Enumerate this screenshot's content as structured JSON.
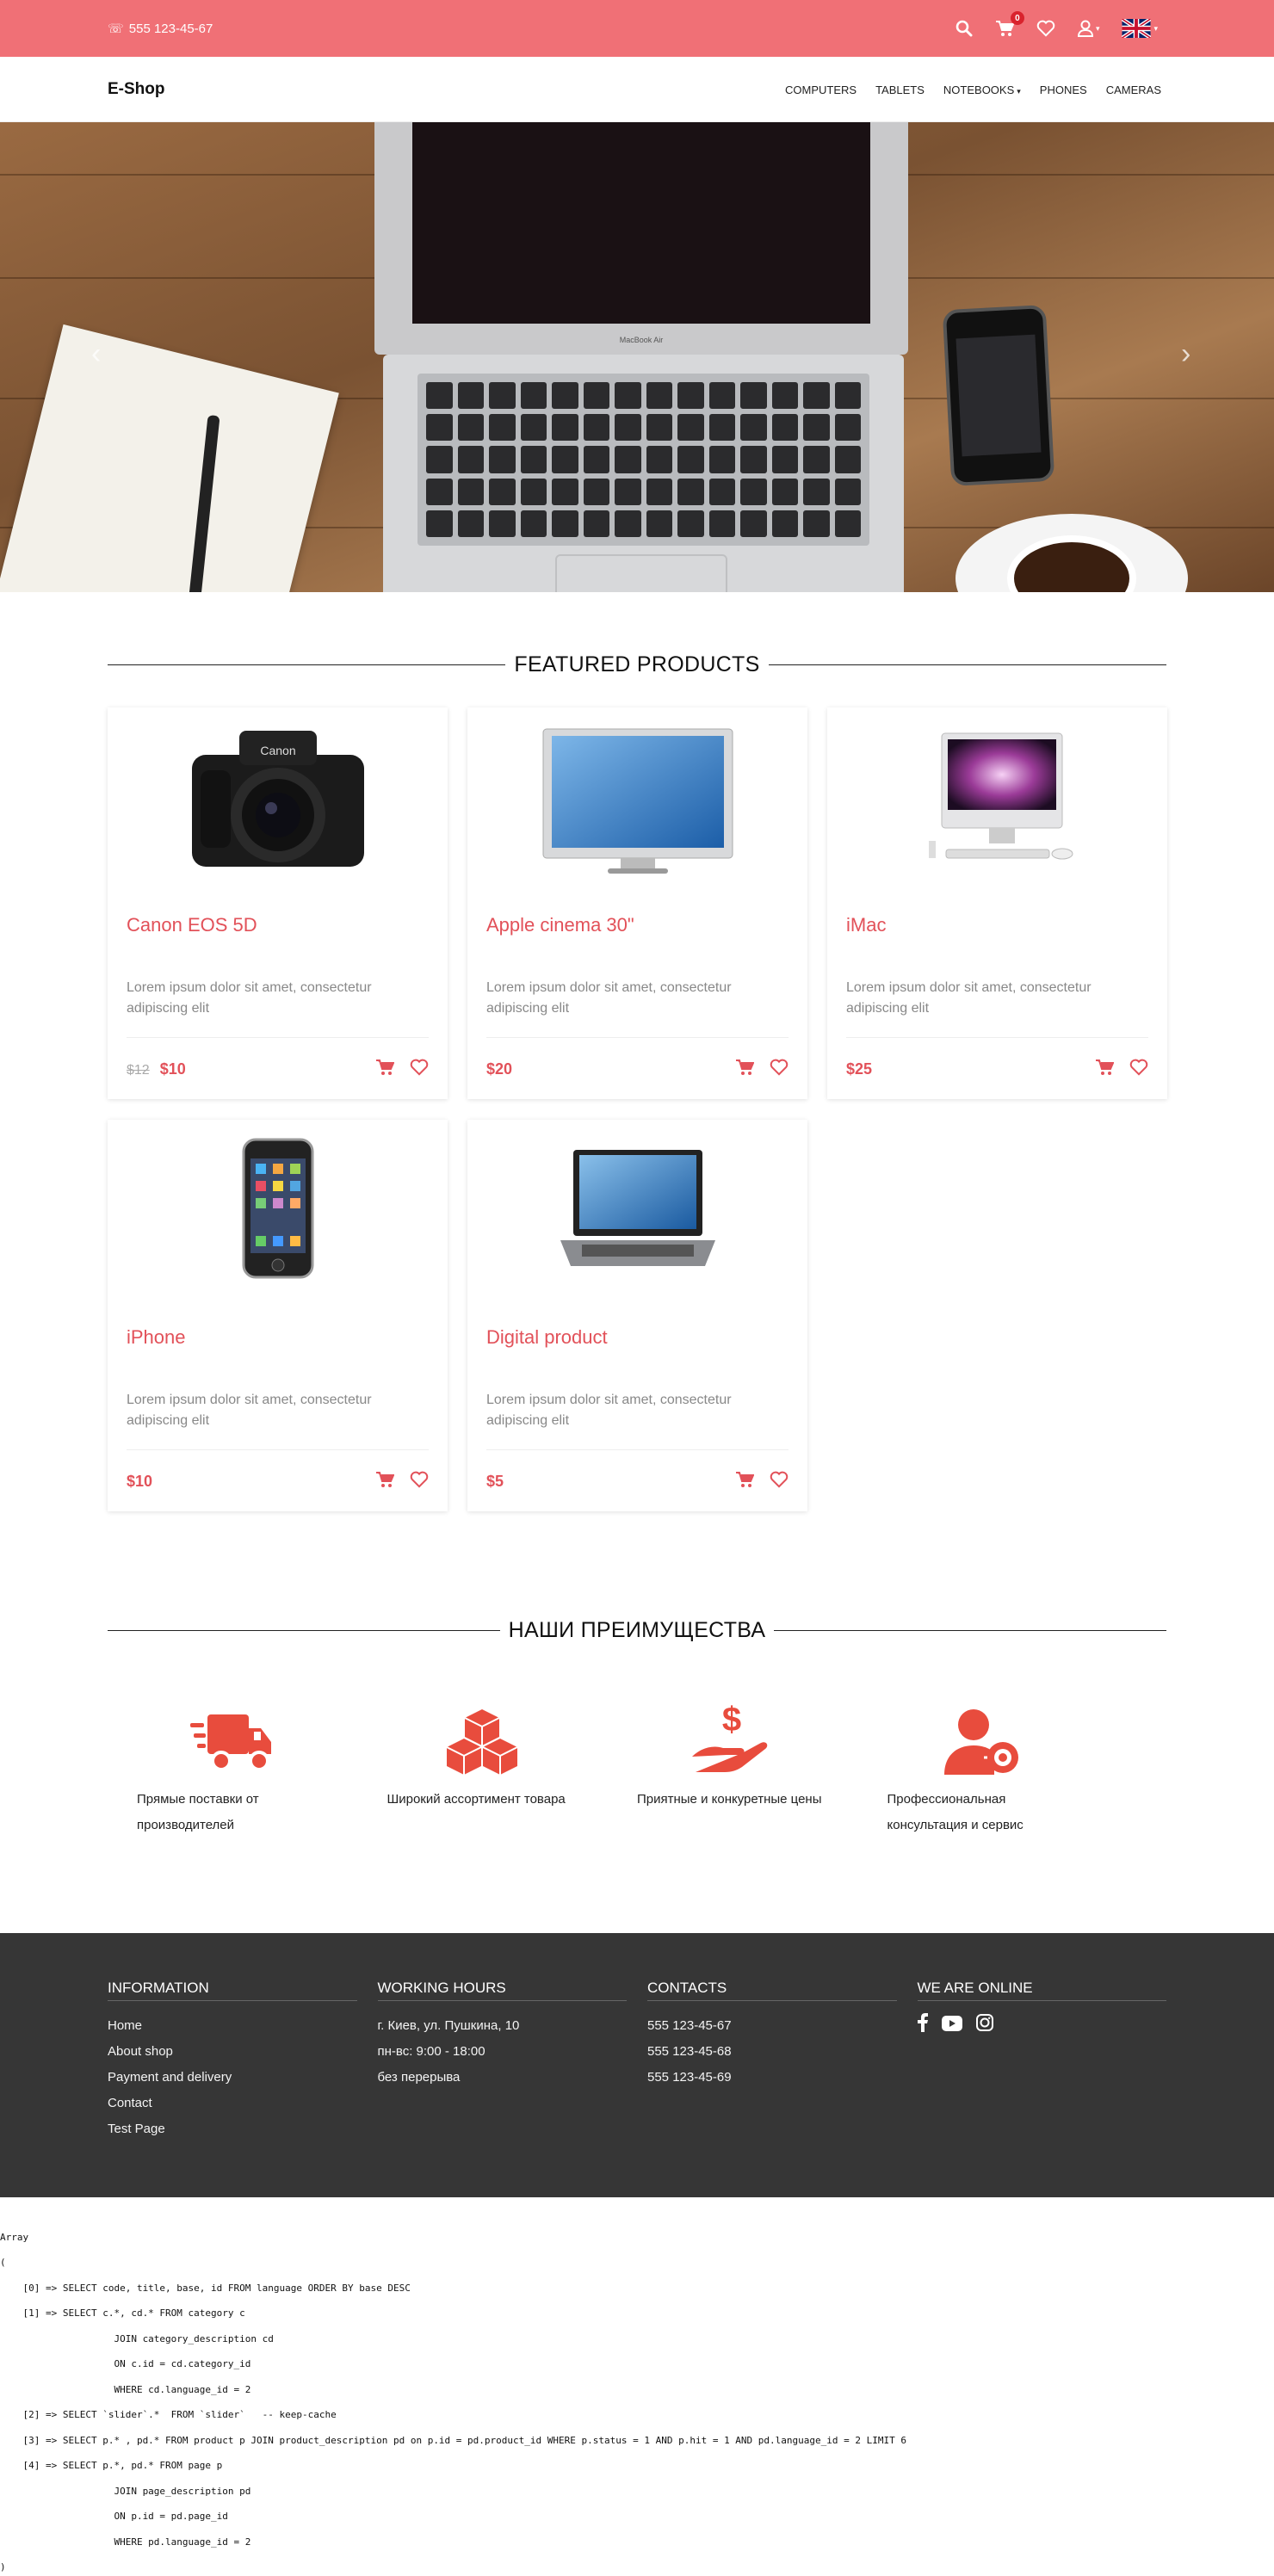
{
  "topbar": {
    "phone": "555 123-45-67",
    "cart_count": "0",
    "colors": {
      "bar": "#f07076",
      "badge": "#d9232d"
    }
  },
  "nav": {
    "brand": "E-Shop",
    "items": [
      "COMPUTERS",
      "TABLETS",
      "NOTEBOOKS",
      "PHONES",
      "CAMERAS"
    ]
  },
  "featured": {
    "title": "FEATURED PRODUCTS",
    "products": [
      {
        "name": "Canon EOS 5D",
        "desc": "Lorem ipsum dolor sit amet, consectetur adipiscing elit",
        "old_price": "$12",
        "price": "$10"
      },
      {
        "name": "Apple cinema 30\"",
        "desc": "Lorem ipsum dolor sit amet, consectetur adipiscing elit",
        "old_price": "",
        "price": "$20"
      },
      {
        "name": "iMac",
        "desc": "Lorem ipsum dolor sit amet, consectetur adipiscing elit",
        "old_price": "",
        "price": "$25"
      },
      {
        "name": "iPhone",
        "desc": "Lorem ipsum dolor sit amet, consectetur adipiscing elit",
        "old_price": "",
        "price": "$10"
      },
      {
        "name": "Digital product",
        "desc": "Lorem ipsum dolor sit amet, consectetur adipiscing elit",
        "old_price": "",
        "price": "$5"
      }
    ]
  },
  "advantages": {
    "title": "НАШИ ПРЕИМУЩЕСТВА",
    "items": [
      {
        "icon": "truck-icon",
        "text": "Прямые поставки от производителей"
      },
      {
        "icon": "boxes-icon",
        "text": "Широкий ассортимент товара"
      },
      {
        "icon": "money-hand-icon",
        "text": "Приятные и конкуретные цены"
      },
      {
        "icon": "user-gear-icon",
        "text": "Профессиональная консультация и сервис"
      }
    ]
  },
  "footer": {
    "information": {
      "title": "INFORMATION",
      "links": [
        "Home",
        "About shop",
        "Payment and delivery",
        "Contact",
        "Test Page"
      ]
    },
    "hours": {
      "title": "WORKING HOURS",
      "lines": [
        "г. Киев, ул. Пушкина, 10",
        "пн-вс: 9:00 - 18:00",
        "без перерыва"
      ]
    },
    "contacts": {
      "title": "CONTACTS",
      "lines": [
        "555 123-45-67",
        "555 123-45-68",
        "555 123-45-69"
      ]
    },
    "online": {
      "title": "WE ARE ONLINE",
      "icons": [
        "facebook-icon",
        "youtube-icon",
        "instagram-icon"
      ]
    }
  },
  "debug": {
    "lines": [
      "Array",
      "(",
      "    [0] => SELECT code, title, base, id FROM language ORDER BY base DESC",
      "    [1] => SELECT c.*, cd.* FROM category c",
      "                    JOIN category_description cd",
      "                    ON c.id = cd.category_id",
      "                    WHERE cd.language_id = 2",
      "    [2] => SELECT `slider`.*  FROM `slider`   -- keep-cache",
      "    [3] => SELECT p.* , pd.* FROM product p JOIN product_description pd on p.id = pd.product_id WHERE p.status = 1 AND p.hit = 1 AND pd.language_id = 2 LIMIT 6",
      "    [4] => SELECT p.*, pd.* FROM page p",
      "                    JOIN page_description pd",
      "                    ON p.id = pd.page_id",
      "                    WHERE pd.language_id = 2",
      ")"
    ]
  }
}
